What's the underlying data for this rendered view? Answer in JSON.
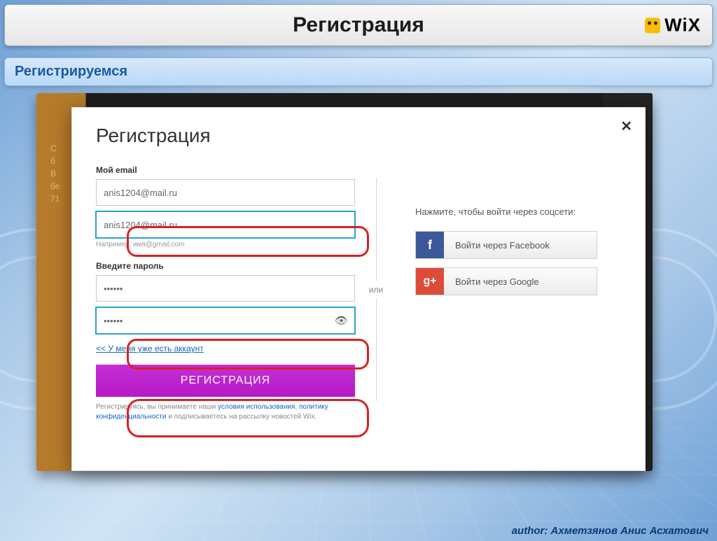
{
  "header": {
    "title": "Регистрация",
    "brand": "WiX"
  },
  "subheader": {
    "text": "Регистрируемся"
  },
  "backdrop": {
    "left_text": "С\nб\nВ\nбе\n71"
  },
  "modal": {
    "title": "Регистрация",
    "close": "✕",
    "email_label": "Мой email",
    "email_value": "anis1204@mail.ru",
    "email_confirm_value": "anis1204@mail.ru",
    "email_hint": "Например, имя@gmail.com",
    "password_label": "Введите пароль",
    "password_value": "••••••",
    "password_confirm_value": "••••••",
    "login_link": "<< У меня уже есть аккаунт",
    "register_btn": "РЕГИСТРАЦИЯ",
    "terms_prefix": "Регистрируясь, вы принимаете наши ",
    "terms_link1": "условия использования",
    "terms_sep": ", ",
    "terms_link2": "политику конфиденциальности",
    "terms_suffix": " и подписываетесь на рассылку новостей Wix.",
    "or": "или",
    "social_label": "Нажмите, чтобы войти через соцсети:",
    "fb_label": "Войти через Facebook",
    "gp_label": "Войти через Google"
  },
  "footer": {
    "author_prefix": "author: ",
    "author_name": "Ахметзянов Анис Асхатович"
  }
}
